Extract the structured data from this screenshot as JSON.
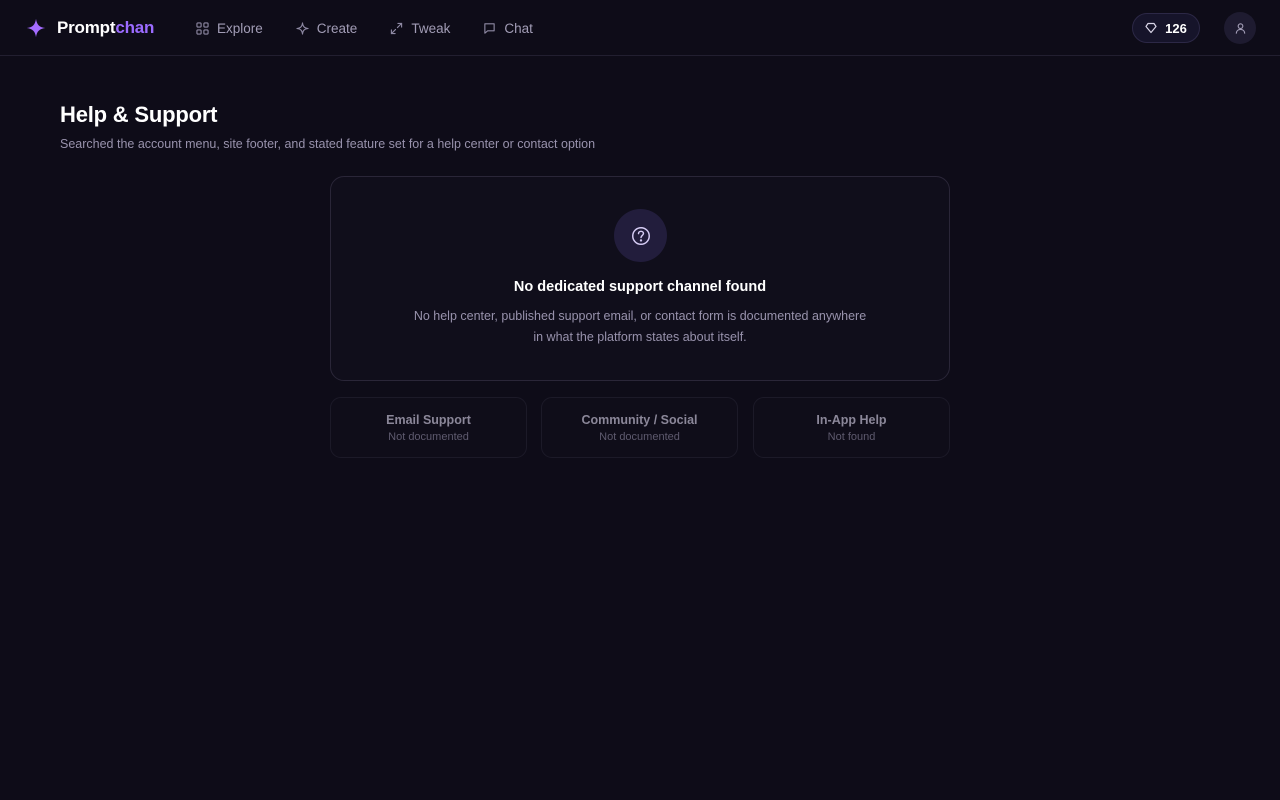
{
  "brand": {
    "name_part1": "Prompt",
    "name_part2": "chan",
    "icon": "sparkle-icon",
    "accent_color": "#9b6bff"
  },
  "nav": {
    "items": [
      {
        "label": "Explore",
        "icon": "grid-icon"
      },
      {
        "label": "Create",
        "icon": "sparkle-outline-icon"
      },
      {
        "label": "Tweak",
        "icon": "expand-arrows-icon"
      },
      {
        "label": "Chat",
        "icon": "chat-bubble-icon"
      }
    ]
  },
  "header": {
    "credits": {
      "value": "126",
      "icon": "gem-icon"
    },
    "account": {
      "icon": "user-icon"
    }
  },
  "page": {
    "title": "Help & Support",
    "subtitle": "Searched the account menu, site footer, and stated feature set for a help center or contact option"
  },
  "notice": {
    "icon": "question-circle-icon",
    "heading": "No dedicated support channel found",
    "body_line1": "No help center, published support email, or contact form is documented anywhere",
    "body_line2": "in what the platform states about itself."
  },
  "channels": [
    {
      "title": "Email Support",
      "status": "Not documented"
    },
    {
      "title": "Community / Social",
      "status": "Not documented"
    },
    {
      "title": "In-App Help",
      "status": "Not found"
    }
  ],
  "colors": {
    "background": "#0e0c18",
    "surface": "#100e1b",
    "border": "#2a2638",
    "muted_text": "#9892ac"
  }
}
